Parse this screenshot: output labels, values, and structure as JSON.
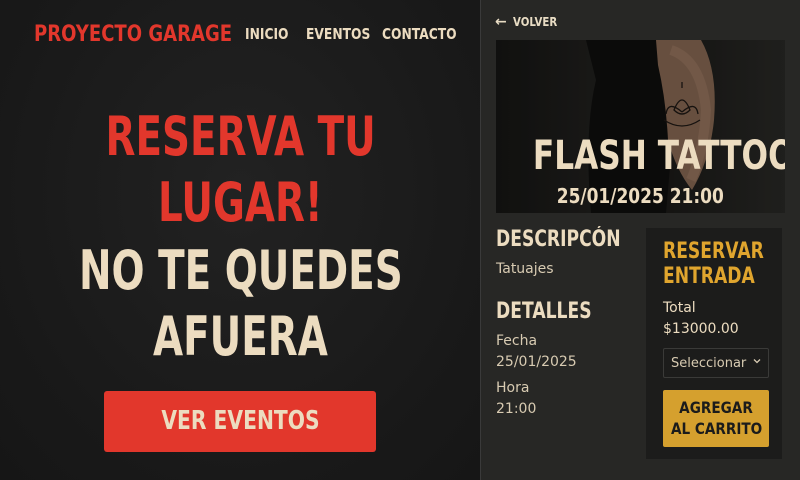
{
  "nav": {
    "brand": "PROYECTO GARAGE",
    "links": [
      "INICIO",
      "EVENTOS",
      "CONTACTO"
    ]
  },
  "hero": {
    "lines": [
      "RESERVA TU",
      "LUGAR!",
      "NO TE QUEDES",
      "AFUERA"
    ],
    "cta_label": "VER EVENTOS"
  },
  "event": {
    "back_label": "VOLVER",
    "title": "FLASH TATTOO",
    "datetime": "25/01/2025 21:00",
    "description_title": "DESCRIPCÓN",
    "description": "Tatuajes",
    "details_title": "DETALLES",
    "fecha_label": "Fecha",
    "fecha_value": "25/01/2025",
    "hora_label": "Hora",
    "hora_value": "21:00"
  },
  "booking": {
    "title_line1": "RESERVAR",
    "title_line2": "ENTRADA",
    "total_label": "Total",
    "total_value": "$13000.00",
    "select_value": "Seleccionar",
    "add_line1": "AGREGAR",
    "add_line2": "AL CARRITO"
  },
  "colors": {
    "accent_red": "#e2372c",
    "cream": "#ecdcc0",
    "gold": "#d5a02e",
    "background": "#1b1b1b"
  },
  "icons": {
    "back": "arrow-left-icon",
    "select": "chevron-down-icon"
  }
}
